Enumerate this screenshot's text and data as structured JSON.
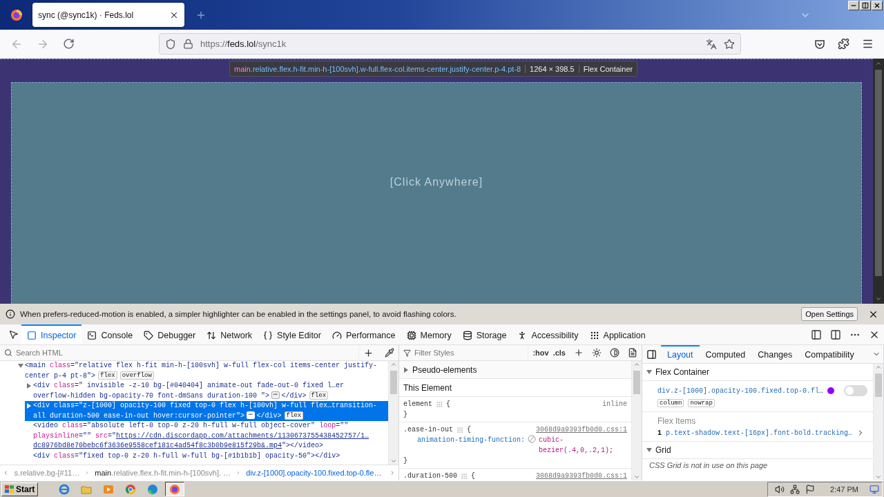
{
  "browser": {
    "tabs": [
      {
        "title": "sync (@sync1k) · Feds.lol",
        "selected": true
      }
    ],
    "url": {
      "scheme": "https://",
      "host": "feds.lol",
      "path": "/sync1k"
    }
  },
  "page": {
    "overlay_text": "[Click Anywhere]",
    "highlighter": {
      "tag": "main",
      "classes": ".relative.flex.h-fit.min-h-[100svh].w-full.flex-col.items-center.justify-center.p-4.pt-8",
      "size": "1264 × 398.5",
      "type": "Flex Container"
    }
  },
  "notification": {
    "message": "When prefers-reduced-motion is enabled, a simpler highlighter can be enabled in the settings panel, to avoid flashing colors.",
    "button": "Open Settings"
  },
  "devtools": {
    "tabs": [
      {
        "label": "Inspector",
        "selected": true
      },
      {
        "label": "Console",
        "selected": false
      },
      {
        "label": "Debugger",
        "selected": false
      },
      {
        "label": "Network",
        "selected": false
      },
      {
        "label": "Style Editor",
        "selected": false
      },
      {
        "label": "Performance",
        "selected": false
      },
      {
        "label": "Memory",
        "selected": false
      },
      {
        "label": "Storage",
        "selected": false
      },
      {
        "label": "Accessibility",
        "selected": false
      },
      {
        "label": "Application",
        "selected": false
      }
    ]
  },
  "inspector": {
    "search_placeholder": "Search HTML",
    "markup": [
      {
        "expanded": true,
        "selected": false,
        "tokens": [
          {
            "kind": "tag",
            "text": "<main"
          },
          {
            "kind": "attr",
            "text": " class"
          },
          {
            "kind": "punct",
            "text": "=\""
          },
          {
            "kind": "value",
            "text": "relative flex h-fit min-h-[100svh] w-full flex-col items-center justify-center p-4 pt-8"
          },
          {
            "kind": "punct",
            "text": "\">"
          }
        ],
        "badges": [
          "flex",
          "overflow"
        ],
        "children": [
          {
            "expanded": false,
            "selected": false,
            "tokens": [
              {
                "kind": "tag",
                "text": "<div"
              },
              {
                "kind": "attr",
                "text": " class"
              },
              {
                "kind": "punct",
                "text": "=\""
              },
              {
                "kind": "value",
                "text": " invisible -z-10 bg-[#040404] animate-out fade-out-0 fixed l…er overflow-hidden bg-opacity-70 font-dmSans duration-100 "
              },
              {
                "kind": "punct",
                "text": "\">"
              }
            ],
            "more": "⋯",
            "close": "</div>",
            "badges": [
              "flex"
            ]
          },
          {
            "expanded": false,
            "selected": true,
            "tokens": [
              {
                "kind": "tag",
                "text": "<div"
              },
              {
                "kind": "attr",
                "text": " class"
              },
              {
                "kind": "punct",
                "text": "=\""
              },
              {
                "kind": "value",
                "text": "z-[1000] opacity-100 fixed top-0 flex h-[100vh] w-full flex…transition-all duration-500 ease-in-out hover:cursor-pointer"
              },
              {
                "kind": "punct",
                "text": "\">"
              }
            ],
            "more": "⋯",
            "close": "</div>",
            "badges": [
              "flex"
            ]
          },
          {
            "selected": false,
            "tokens": [
              {
                "kind": "tag",
                "text": "<video"
              },
              {
                "kind": "attr",
                "text": " class"
              },
              {
                "kind": "punct",
                "text": "=\""
              },
              {
                "kind": "value",
                "text": "absolute left-0 top-0 z-20 h-full w-full object-cover"
              },
              {
                "kind": "punct",
                "text": "\""
              },
              {
                "kind": "attr",
                "text": " loop"
              },
              {
                "kind": "punct",
                "text": "=\"\""
              },
              {
                "kind": "attr",
                "text": " playsinline"
              },
              {
                "kind": "punct",
                "text": "=\"\""
              },
              {
                "kind": "attr",
                "text": " src"
              },
              {
                "kind": "punct",
                "text": "=\""
              },
              {
                "kind": "link",
                "text": "https://cdn.discordapp.com/attachments/1130673755438452757/1… dc8976bd8e70bebc6f3636e9558cef181c4ad54f8c3b0b9e815f29b&.mp4"
              },
              {
                "kind": "punct",
                "text": "\">"
              }
            ],
            "close": "</video>"
          },
          {
            "selected": false,
            "tokens": [
              {
                "kind": "tag",
                "text": "<div"
              },
              {
                "kind": "attr",
                "text": " class"
              },
              {
                "kind": "punct",
                "text": "=\""
              },
              {
                "kind": "value",
                "text": "fixed top-0 z-20 h-full w-full bg-[#1b1b1b] opacity-50"
              },
              {
                "kind": "punct",
                "text": "\">"
              }
            ],
            "close": "</div>"
          }
        ]
      }
    ],
    "breadcrumbs": [
      {
        "classes": "s.relative.bg-[#11…",
        "selected": false
      },
      {
        "tag": "main",
        "classes": ".relative.flex.h-fit.min-h-[100svh]. …",
        "selected": false
      },
      {
        "tag": "div",
        "classes": ".z-[1000].opacity-100.fixed.top-0.fle…",
        "selected": true
      }
    ]
  },
  "rules": {
    "filter_placeholder": "Filter Styles",
    "pseudo_toggle": ":hov",
    "class_toggle": ".cls",
    "pseudo_elements": {
      "label": "Pseudo-elements",
      "expanded": false
    },
    "header": "This Element",
    "list": [
      {
        "selector": "element",
        "brace": "{",
        "source": "inline",
        "end": "}"
      },
      {
        "selector": ".ease-in-out",
        "brace": "{",
        "source": "3068d9a9393fb0d0.css:1",
        "declarations": [
          {
            "property": "animation-timing-function:",
            "value": "cubic-bezier(.4,0,.2,1);"
          }
        ],
        "end": "}"
      },
      {
        "selector": ".duration-500",
        "brace": "{",
        "source": "3068d9a9393fb0d0.css:1"
      }
    ]
  },
  "layout": {
    "tabs": [
      {
        "label": "Layout",
        "selected": true
      },
      {
        "label": "Computed",
        "selected": false
      },
      {
        "label": "Changes",
        "selected": false
      },
      {
        "label": "Compatibility",
        "selected": false
      }
    ],
    "flex_container": {
      "title": "Flex Container",
      "expanded": true,
      "selector": "div.z-[1000].opacity-100.fixed.top-0.fl…",
      "highlight_on": false,
      "badges": [
        "column",
        "nowrap"
      ]
    },
    "flex_items": {
      "title": "Flex Items",
      "items": [
        {
          "index": "1",
          "selector": "p.text-shadow.text-[16px].font-bold.tracking…"
        }
      ]
    },
    "grid": {
      "title": "Grid",
      "expanded": true,
      "message": "CSS Grid is not in use on this page"
    }
  },
  "taskbar": {
    "start": "Start",
    "apps": [
      {
        "selected": false
      },
      {
        "selected": false
      },
      {
        "selected": false
      },
      {
        "selected": false
      },
      {
        "selected": false
      },
      {
        "selected": true
      }
    ],
    "time": "2:47 PM"
  }
}
